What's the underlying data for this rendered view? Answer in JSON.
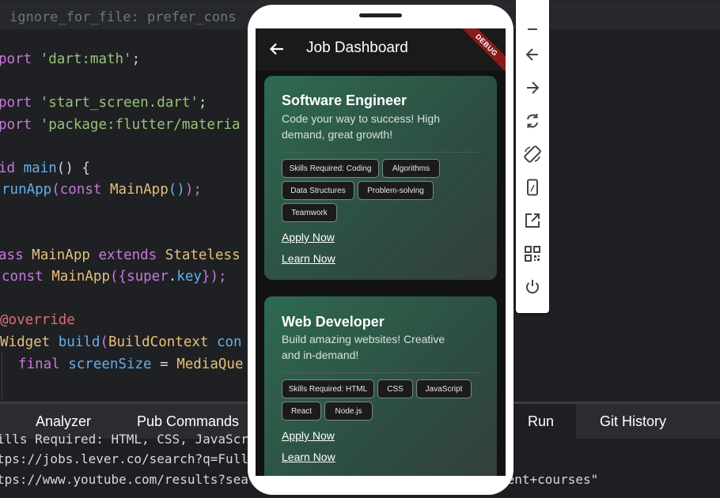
{
  "editor": {
    "hint": "ignore_for_file: prefer_cons",
    "lines": {
      "l1_kw": "port",
      "l1_str": "'dart:math'",
      "l1_end": ";",
      "l2_kw": "port",
      "l2_str": "'start_screen.dart'",
      "l2_end": ";",
      "l3_kw": "port",
      "l3_str": "'package:flutter/materia",
      "l4_kw": "id",
      "l4_fn": "main",
      "l4_rest": "() {",
      "l5_fn": "runApp",
      "l5_p1": "(",
      "l5_kw": "const",
      "l5_cls": "MainApp",
      "l5_p2": "()",
      "l5_end": ");",
      "l6_kw": "ass",
      "l6_cls": "MainApp",
      "l6_kw2": "extends",
      "l6_cls2": "Stateless",
      "l7_kw": "const",
      "l7_cls": "MainApp",
      "l7_p1": "({",
      "l7_kw2": "super",
      "l7_dot": ".",
      "l7_prop": "key",
      "l7_end": "});",
      "l8_ann": "@override",
      "l9_cls": "Widget",
      "l9_fn": "build",
      "l9_p1": "(",
      "l9_cls2": "BuildContext",
      "l9_rest": "con",
      "l10_kw": "final",
      "l10_var": "screenSize",
      "l10_eq": " = ",
      "l10_cls": "MediaQue"
    }
  },
  "panel": {
    "tabs": [
      "Analyzer",
      "Pub Commands",
      "Run",
      "Git History"
    ],
    "active_tab": "Run",
    "console": [
      "ills Required: HTML, CSS, JavaScr",
      "tps://jobs.lever.co/search?q=Full",
      "tps://www.youtube.com/results?sea",
      "ment+courses\""
    ]
  },
  "emulator_toolbar": {
    "icons": [
      "minimize-icon",
      "back-icon",
      "forward-icon",
      "rotate-icon",
      "rotate-device-icon",
      "phone-icon",
      "external-link-icon",
      "qr-code-icon",
      "power-icon"
    ]
  },
  "app": {
    "title": "Job Dashboard",
    "debug_label": "DEBUG",
    "cards": [
      {
        "title": "Software Engineer",
        "desc": "Code your way to success! High demand, great growth!",
        "chips": [
          "Skills Required: Coding",
          "Algorithms",
          "Data Structures",
          "Problem-solving",
          "Teamwork"
        ],
        "apply": "Apply Now",
        "learn": "Learn Now"
      },
      {
        "title": "Web Developer",
        "desc": "Build amazing websites!  Creative and in-demand!",
        "chips": [
          "Skills Required: HTML",
          "CSS",
          "JavaScript",
          "React",
          "Node.js"
        ],
        "apply": "Apply Now",
        "learn": "Learn Now"
      }
    ]
  },
  "colors": {
    "editor_bg": "#1f2023",
    "keyword": "#c678dd",
    "string": "#98c379",
    "function": "#61afef",
    "class": "#e5c07b",
    "annotation": "#e06c75",
    "card_green": "#2e6a52",
    "debug_red": "#8b1a1a"
  }
}
